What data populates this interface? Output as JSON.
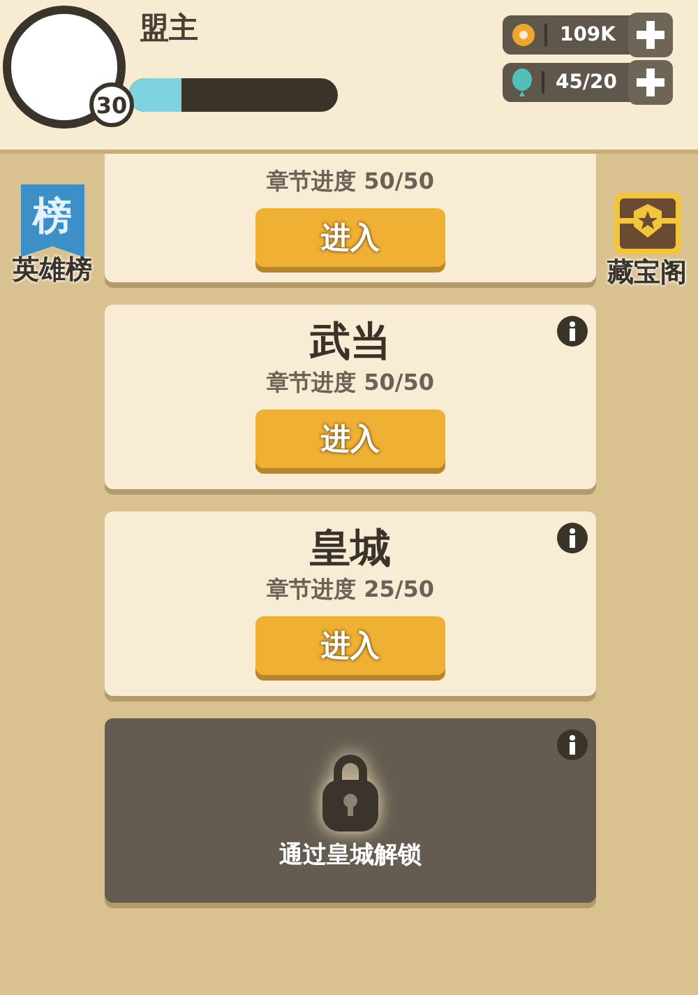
{
  "player": {
    "name": "盟主",
    "level_badge": "30",
    "exp": {
      "level": 0.25
    }
  },
  "resources": [
    {
      "kind": "coin",
      "value": "109K"
    },
    {
      "kind": "balloon",
      "value": "45/20"
    }
  ],
  "side_buttons": [
    {
      "kind": "banner",
      "badge_text": "榜",
      "label": "英雄榜"
    },
    {
      "kind": "chest",
      "label": "藏宝阁"
    }
  ],
  "chapters": [
    {
      "kind": "open",
      "info": false,
      "progress": "章节进度 50/50",
      "button": "进入"
    },
    {
      "kind": "open",
      "info": true,
      "title": "武当",
      "progress": "章节进度 50/50",
      "button": "进入"
    },
    {
      "kind": "open",
      "info": true,
      "title": "皇城",
      "progress": "章节进度 25/50",
      "button": "进入"
    },
    {
      "kind": "locked",
      "info": true,
      "message": "通过皇城解锁"
    }
  ]
}
